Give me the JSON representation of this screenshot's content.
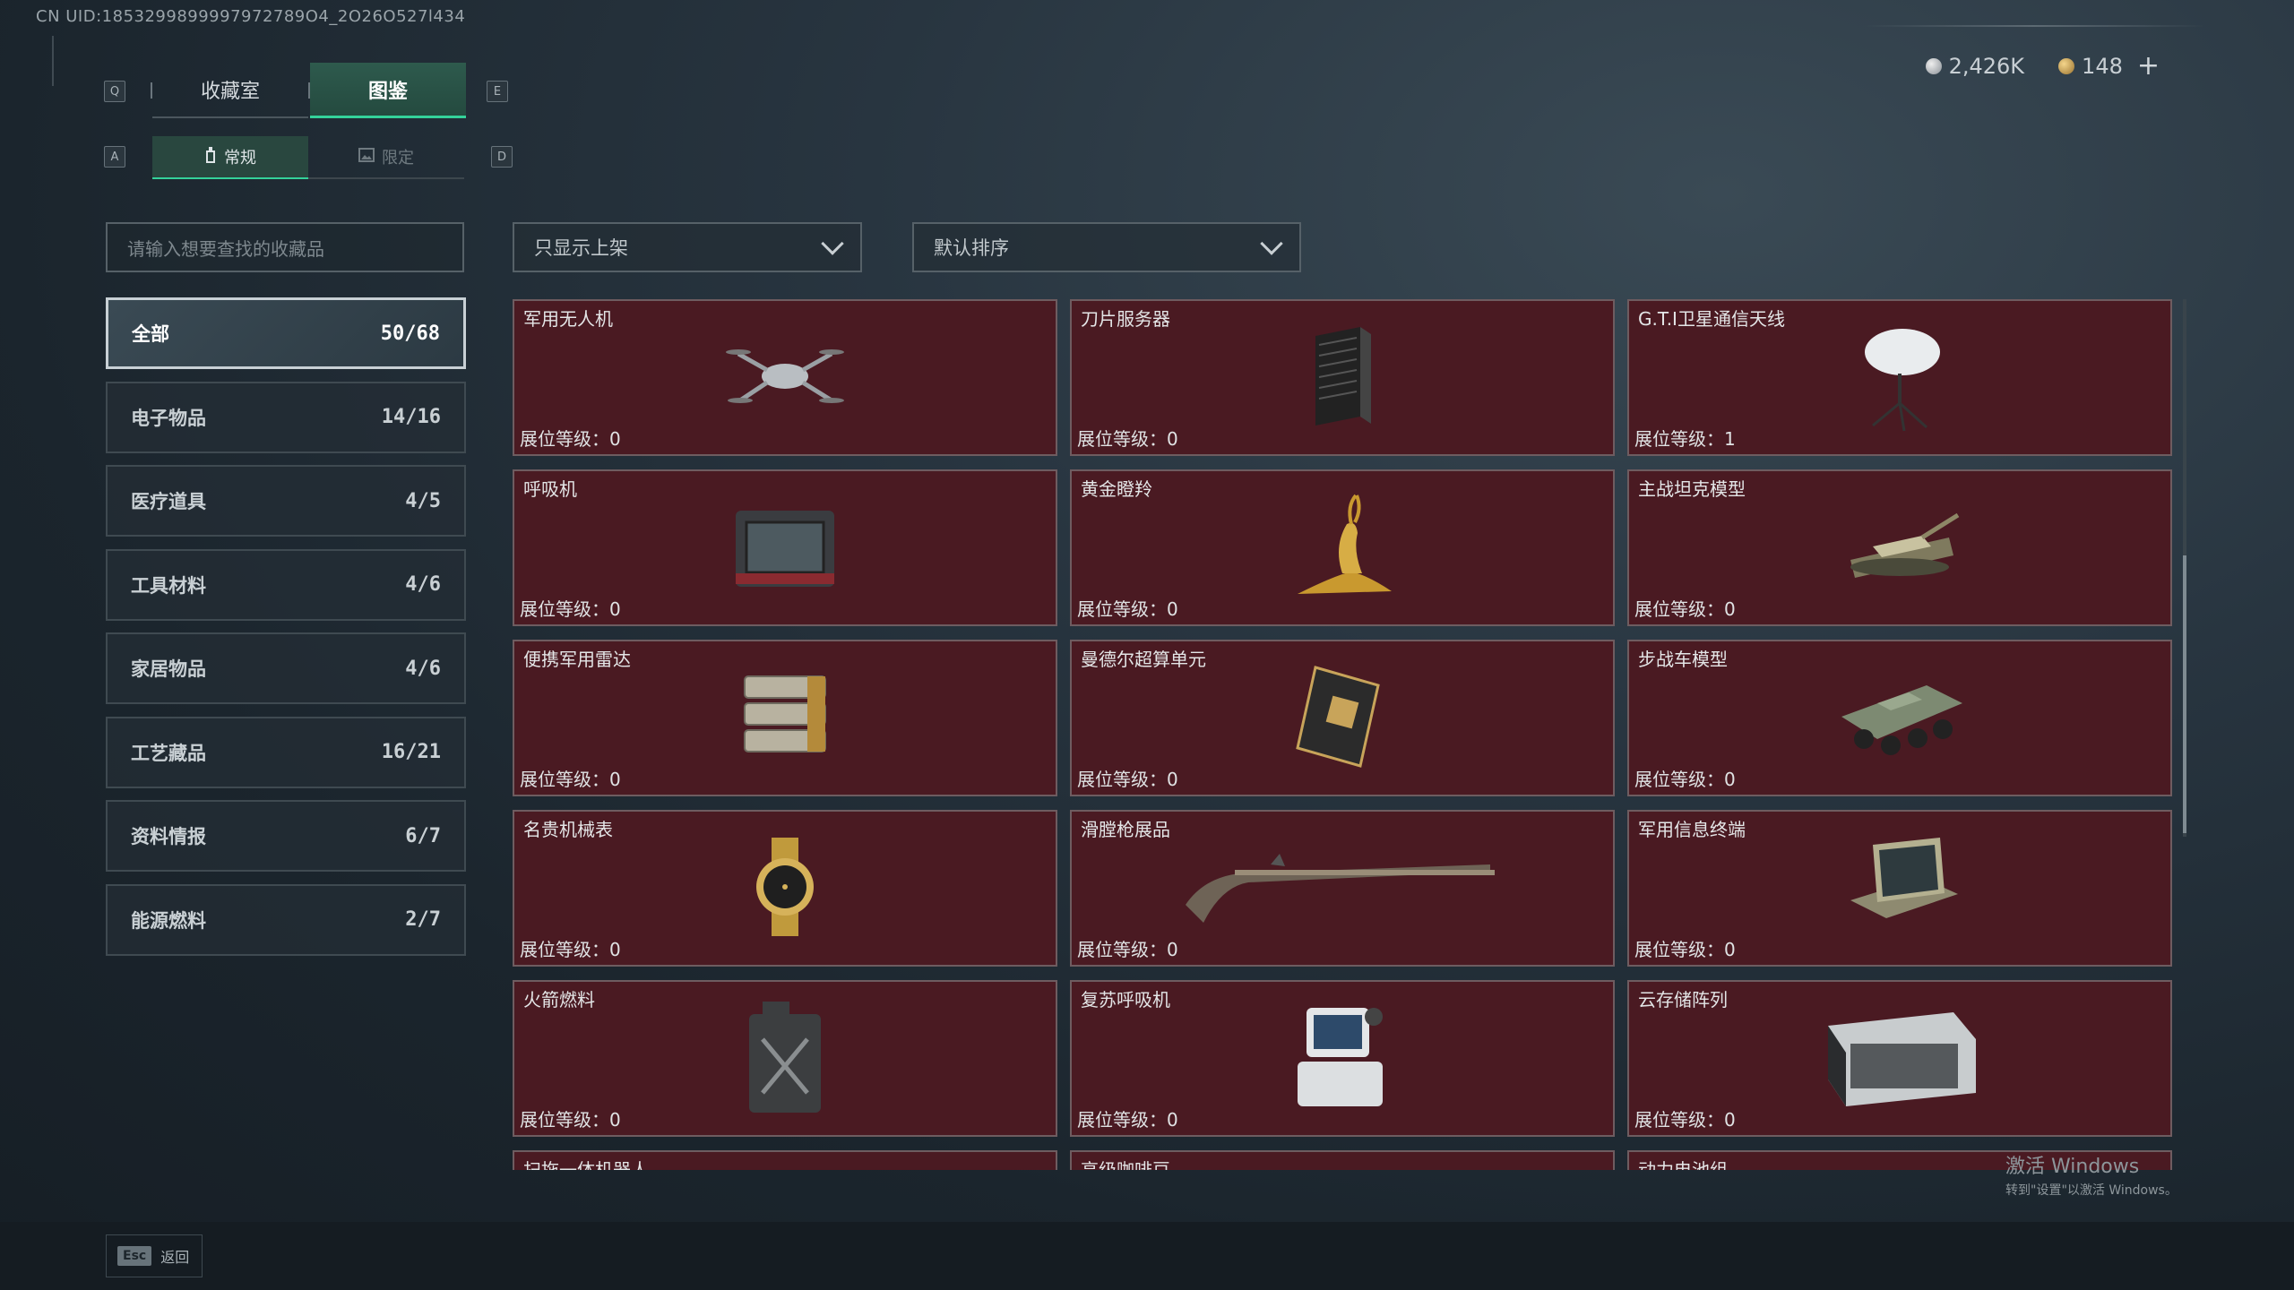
{
  "uid": "CN UID:1853299899997972789O4_2O26O527l434",
  "currency": {
    "silver": "2,426K",
    "gold": "148",
    "add": "+"
  },
  "keys": {
    "prev_tab": "Q",
    "next_tab": "E",
    "prev_sub": "A",
    "next_sub": "D"
  },
  "tabs": [
    {
      "label": "收藏室",
      "active": false
    },
    {
      "label": "图鉴",
      "active": true
    }
  ],
  "subtabs": [
    {
      "label": "常规",
      "icon": "bottle-icon",
      "active": true
    },
    {
      "label": "限定",
      "icon": "image-icon",
      "active": false
    }
  ],
  "search": {
    "placeholder": "请输入想要查找的收藏品"
  },
  "filters": {
    "shelf": "只显示上架",
    "sort": "默认排序"
  },
  "categories": [
    {
      "label": "全部",
      "count": "50/68"
    },
    {
      "label": "电子物品",
      "count": "14/16"
    },
    {
      "label": "医疗道具",
      "count": "4/5"
    },
    {
      "label": "工具材料",
      "count": "4/6"
    },
    {
      "label": "家居物品",
      "count": "4/6"
    },
    {
      "label": "工艺藏品",
      "count": "16/21"
    },
    {
      "label": "资料情报",
      "count": "6/7"
    },
    {
      "label": "能源燃料",
      "count": "2/7"
    }
  ],
  "level_label": "展位等级：",
  "items": [
    {
      "name": "军用无人机",
      "level": "0",
      "icon": "drone-icon"
    },
    {
      "name": "刀片服务器",
      "level": "0",
      "icon": "server-icon"
    },
    {
      "name": "G.T.I卫星通信天线",
      "level": "1",
      "icon": "satellite-dish-icon"
    },
    {
      "name": "呼吸机",
      "level": "0",
      "icon": "ventilator-icon"
    },
    {
      "name": "黄金瞪羚",
      "level": "0",
      "icon": "golden-gazelle-icon"
    },
    {
      "name": "主战坦克模型",
      "level": "0",
      "icon": "tank-icon"
    },
    {
      "name": "便携军用雷达",
      "level": "0",
      "icon": "radar-icon"
    },
    {
      "name": "曼德尔超算单元",
      "level": "0",
      "icon": "gpu-icon"
    },
    {
      "name": "步战车模型",
      "level": "0",
      "icon": "ifv-icon"
    },
    {
      "name": "名贵机械表",
      "level": "0",
      "icon": "watch-icon"
    },
    {
      "name": "滑膛枪展品",
      "level": "0",
      "icon": "musket-icon"
    },
    {
      "name": "军用信息终端",
      "level": "0",
      "icon": "terminal-icon"
    },
    {
      "name": "火箭燃料",
      "level": "0",
      "icon": "fuel-can-icon"
    },
    {
      "name": "复苏呼吸机",
      "level": "0",
      "icon": "resuscitator-icon"
    },
    {
      "name": "云存储阵列",
      "level": "0",
      "icon": "storage-array-icon"
    },
    {
      "name": "扫拖一体机器人",
      "level": "",
      "icon": ""
    },
    {
      "name": "高级咖啡豆",
      "level": "",
      "icon": ""
    },
    {
      "name": "动力电池组",
      "level": "",
      "icon": ""
    }
  ],
  "watermark": {
    "line1": "激活 Windows",
    "line2": "转到\"设置\"以激活 Windows。"
  },
  "footer": {
    "key": "Esc",
    "label": "返回"
  },
  "colors": {
    "accent": "#34d29a",
    "card_bg": "#4a1a22"
  }
}
